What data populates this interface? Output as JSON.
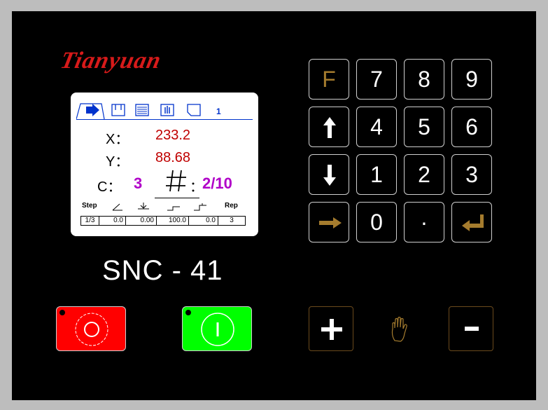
{
  "brand": "Tianyuan",
  "model": "SNC - 41",
  "lcd": {
    "tab_number": "1",
    "x_label": "X：",
    "x_value": "233.2",
    "y_label": "Y：",
    "y_value": "88.68",
    "c_label": "C：",
    "c_value": "3",
    "count_sep": "：",
    "count_value": "2/10",
    "table": {
      "headers": [
        "Step",
        "Rep"
      ],
      "row": [
        "1/3",
        "0.0",
        "0.00",
        "100.0",
        "0.0",
        "3"
      ]
    }
  },
  "keypad": {
    "f": "F",
    "k7": "7",
    "k8": "8",
    "k9": "9",
    "k4": "4",
    "k5": "5",
    "k6": "6",
    "k1": "1",
    "k2": "2",
    "k3": "3",
    "k0": "0",
    "kdot": "·"
  },
  "colors": {
    "stop": "#ff0000",
    "start": "#00ff00",
    "accent_brown": "#a57c2e",
    "lcd_red": "#c00000",
    "lcd_magenta": "#b000c8"
  }
}
